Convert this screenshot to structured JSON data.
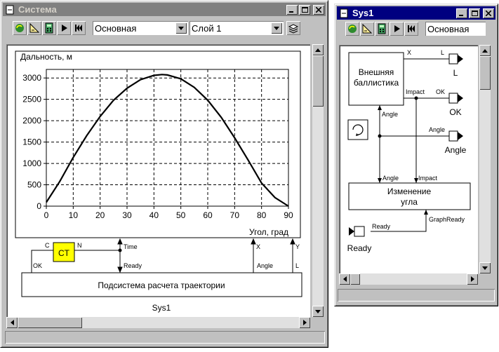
{
  "win1": {
    "title": "Система",
    "layer_combo": "Основная",
    "sublayer_combo": "Слой 1",
    "chart_labels": {
      "ylabel": "Дальность, м",
      "xlabel": "Угол, град"
    },
    "diagram": {
      "counter_block": "CT",
      "port_c": "C",
      "port_n": "N",
      "port_ok": "OK",
      "time_label": "Time",
      "ready_label": "Ready",
      "x_label": "X",
      "y_label": "Y",
      "angle_label": "Angle",
      "l_label": "L",
      "subsystem_block": "Подсистема расчета траектории",
      "subsystem_name": "Sys1"
    }
  },
  "win2": {
    "title": "Sys1",
    "layer_combo": "Основная",
    "diagram": {
      "ballistics_block_line1": "Внешняя",
      "ballistics_block_line2": "баллистика",
      "angle_block_line1": "Изменение",
      "angle_block_line2": "угла",
      "sig_x": "X",
      "sig_impact": "Impact",
      "sig_ok": "OK",
      "sig_angle": "Angle",
      "sig_graphready": "GraphReady",
      "sig_ready": "Ready",
      "out_l": "L",
      "out_ok": "OK",
      "out_angle": "Angle",
      "in_ready": "Ready"
    }
  },
  "chart_data": {
    "type": "line",
    "title": "",
    "xlabel": "Угол, град",
    "ylabel": "Дальность, м",
    "xlim": [
      0,
      90
    ],
    "ylim": [
      0,
      3200
    ],
    "xticks": [
      0,
      10,
      20,
      30,
      40,
      50,
      60,
      70,
      80,
      90
    ],
    "yticks": [
      0,
      500,
      1000,
      1500,
      2000,
      2500,
      3000
    ],
    "grid": true,
    "series": [
      {
        "name": "",
        "color": "#000000",
        "x": [
          0,
          5,
          10,
          15,
          20,
          25,
          30,
          35,
          40,
          43,
          45,
          50,
          55,
          60,
          65,
          70,
          75,
          80,
          85,
          90
        ],
        "y": [
          90,
          580,
          1140,
          1650,
          2100,
          2480,
          2760,
          2960,
          3060,
          3080,
          3070,
          2980,
          2780,
          2480,
          2080,
          1600,
          1080,
          540,
          200,
          0
        ]
      }
    ]
  },
  "colors": {
    "counter_block": "#ffff00",
    "active_title": "#000080",
    "inactive_title": "#808080"
  }
}
